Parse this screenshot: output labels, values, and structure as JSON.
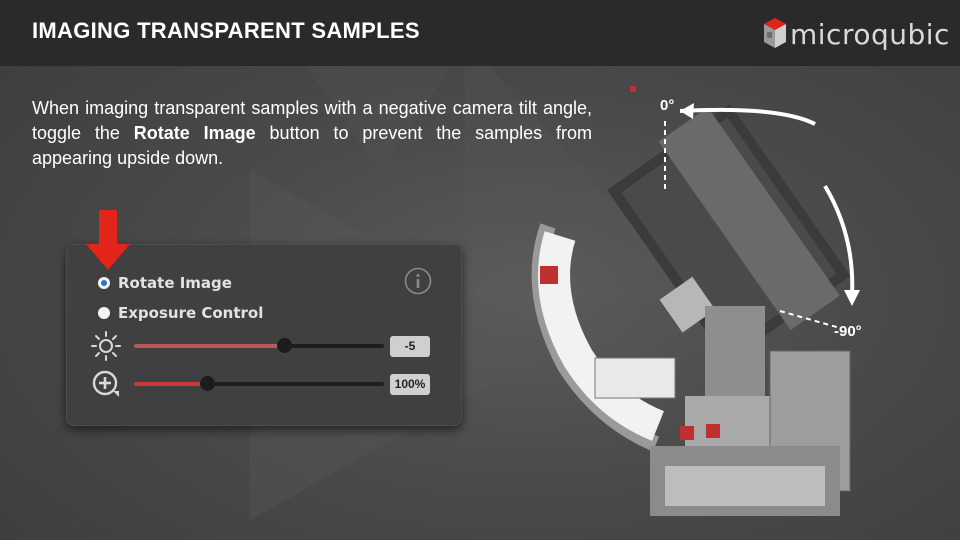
{
  "header": {
    "title": "IMAGING TRANSPARENT SAMPLES",
    "logo_text": "microqubic"
  },
  "description": {
    "before": "When imaging transparent samples with a negative camera tilt angle, toggle the ",
    "bold": "Rotate Image",
    "after": " button to prevent the samples from appearing upside down."
  },
  "panel": {
    "options": [
      {
        "label": "Rotate Image",
        "selected": true
      },
      {
        "label": "Exposure Control",
        "selected": false
      }
    ],
    "info_icon": "info-icon",
    "sliders": [
      {
        "icon": "sun-icon",
        "value_text": "-5",
        "level": 0.6,
        "fill_color": "#b95a5a"
      },
      {
        "icon": "zoom-plus-icon",
        "value_text": "100%",
        "level": 0.29,
        "fill_color": "#c83a3a"
      }
    ]
  },
  "angles": {
    "top": "0°",
    "bottom": "-90°"
  },
  "colors": {
    "header_bg": "#2a2a2a",
    "accent_red": "#e3241b",
    "radio_selected": "#2d6fd1"
  }
}
